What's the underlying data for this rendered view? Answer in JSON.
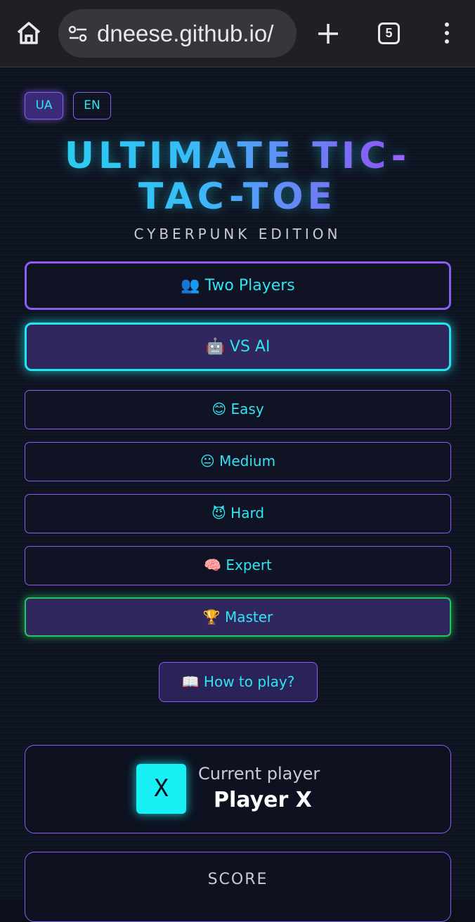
{
  "browser": {
    "url": "dneese.github.io/",
    "tab_count": "5"
  },
  "languages": {
    "ua": "UA",
    "en": "EN"
  },
  "title": "ULTIMATE TIC-TAC-TOE",
  "title_line1": "ULTIMATE TIC-",
  "title_line2": "TAC-TOE",
  "subtitle": "CYBERPUNK EDITION",
  "modes": {
    "two_players": "👥 Two Players",
    "vs_ai": "🤖 VS AI"
  },
  "difficulties": {
    "easy": "😊 Easy",
    "medium": "😐 Medium",
    "hard": "😈 Hard",
    "expert": "🧠 Expert",
    "master": "🏆 Master"
  },
  "how_to_play": "📖 How to play?",
  "current_player": {
    "label": "Current player",
    "symbol": "X",
    "name": "Player X"
  },
  "score": {
    "label": "SCORE"
  },
  "colors": {
    "accent_cyan": "#22e4f0",
    "accent_purple": "#8b5cf6",
    "master_green": "#22c55e"
  }
}
